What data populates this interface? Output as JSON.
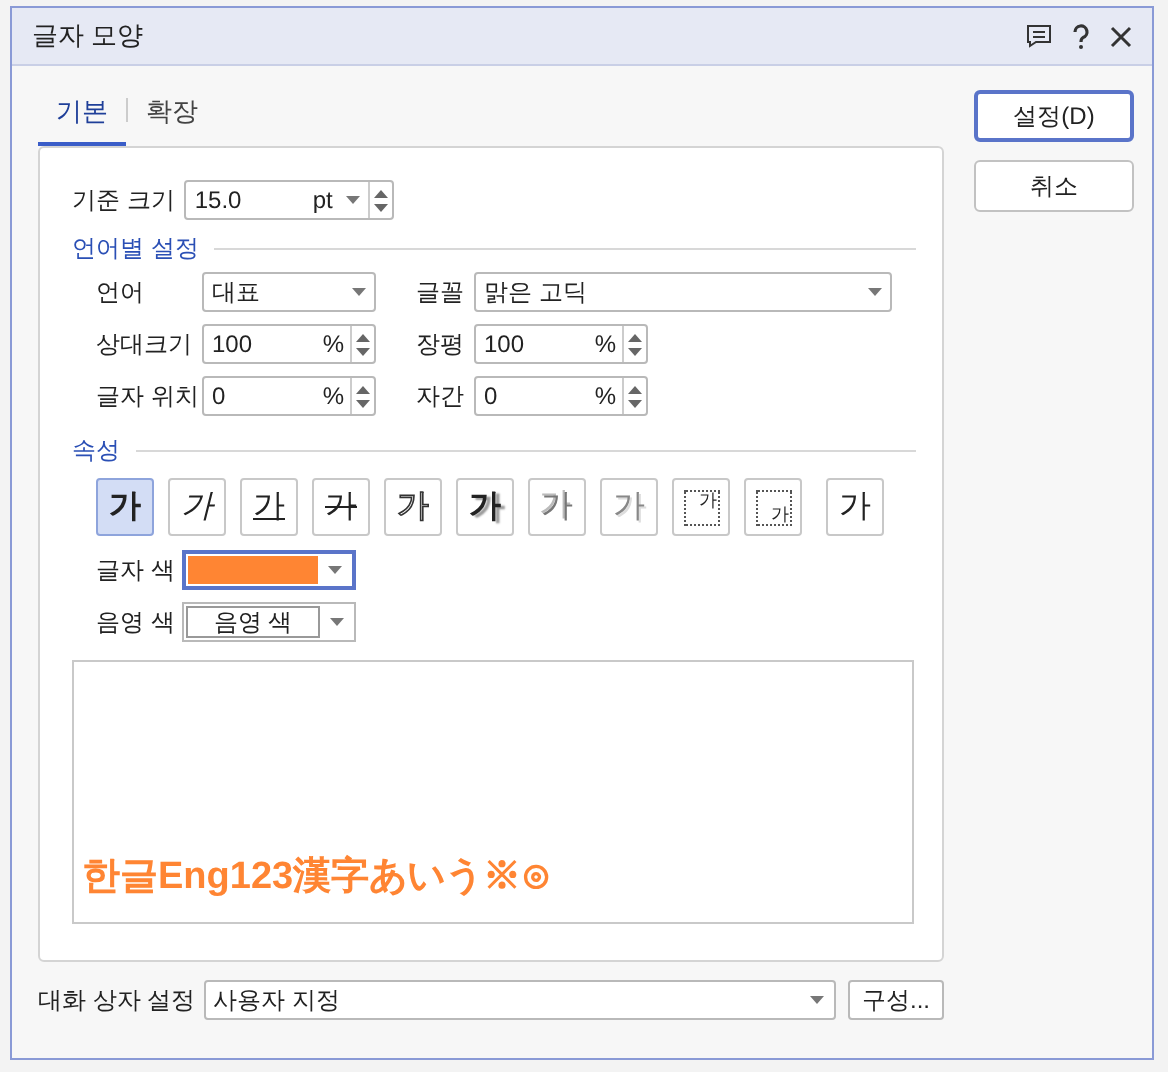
{
  "window": {
    "title": "글자 모양"
  },
  "tabs": [
    {
      "label": "기본",
      "selected": true
    },
    {
      "label": "확장",
      "selected": false
    }
  ],
  "buttons": [
    {
      "label": "설정(D)",
      "default": true
    },
    {
      "label": "취소",
      "default": false
    }
  ],
  "base_size": {
    "label": "기준 크기",
    "value": "15.0",
    "unit": "pt"
  },
  "language_section": {
    "title": "언어별 설정",
    "language": {
      "label": "언어",
      "value": "대표"
    },
    "font": {
      "label": "글꼴",
      "value": "맑은 고딕"
    },
    "relative_size": {
      "label": "상대크기",
      "value": "100",
      "unit": "%"
    },
    "width_ratio": {
      "label": "장평",
      "value": "100",
      "unit": "%"
    },
    "position": {
      "label": "글자 위치",
      "value": "0",
      "unit": "%"
    },
    "spacing": {
      "label": "자간",
      "value": "0",
      "unit": "%"
    }
  },
  "attributes": {
    "title": "속성",
    "items": [
      {
        "label": "가",
        "kind": "bold",
        "selected": true
      },
      {
        "label": "가",
        "kind": "italic",
        "selected": false
      },
      {
        "label": "가",
        "kind": "underline",
        "selected": false
      },
      {
        "label": "가",
        "kind": "strikethrough",
        "selected": false
      },
      {
        "label": "가",
        "kind": "outline",
        "selected": false
      },
      {
        "label": "가",
        "kind": "shadow",
        "selected": false
      },
      {
        "label": "가",
        "kind": "emboss",
        "selected": false
      },
      {
        "label": "가",
        "kind": "engrave",
        "selected": false
      },
      {
        "label": "가",
        "kind": "superscript",
        "selected": false
      },
      {
        "label": "가",
        "kind": "subscript",
        "selected": false
      },
      {
        "label": "가",
        "kind": "normal",
        "selected": false
      }
    ]
  },
  "text_color": {
    "label": "글자 색",
    "color": "#ff8533"
  },
  "shade_color": {
    "label": "음영 색",
    "value": "음영 색"
  },
  "preview": {
    "text": "한글Eng123漢字あいう※⊙"
  },
  "dialog_settings": {
    "label": "대화 상자 설정",
    "value": "사용자 지정",
    "button": "구성..."
  }
}
